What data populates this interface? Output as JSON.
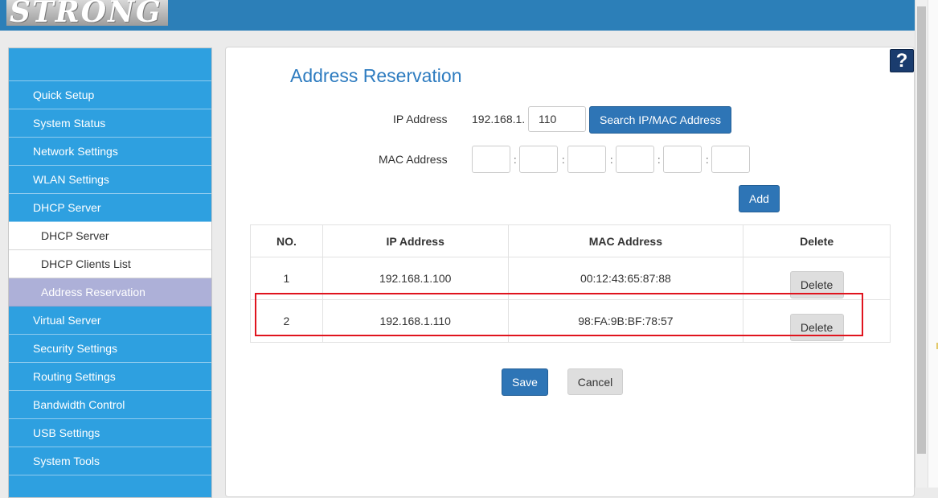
{
  "header": {
    "logo_text": "STRONG"
  },
  "sidebar": {
    "items": [
      {
        "label": "Quick Setup"
      },
      {
        "label": "System Status"
      },
      {
        "label": "Network Settings"
      },
      {
        "label": "WLAN Settings"
      },
      {
        "label": "DHCP Server"
      }
    ],
    "subitems": [
      {
        "label": "DHCP Server"
      },
      {
        "label": "DHCP Clients List"
      },
      {
        "label": "Address Reservation",
        "active": true
      }
    ],
    "items_after": [
      {
        "label": "Virtual Server"
      },
      {
        "label": "Security Settings"
      },
      {
        "label": "Routing Settings"
      },
      {
        "label": "Bandwidth Control"
      },
      {
        "label": "USB Settings"
      },
      {
        "label": "System Tools"
      }
    ]
  },
  "help": {
    "icon": "question-mark-icon",
    "glyph": "?"
  },
  "page": {
    "title": "Address Reservation",
    "ip_label": "IP Address",
    "ip_prefix": "192.168.1.",
    "ip_value": "110",
    "search_button": "Search IP/MAC Address",
    "mac_label": "MAC Address",
    "mac_separator": ":",
    "add_button": "Add"
  },
  "table": {
    "headers": [
      "NO.",
      "IP Address",
      "MAC Address",
      "Delete"
    ],
    "rows": [
      {
        "no": "1",
        "ip": "192.168.1.100",
        "mac": "00:12:43:65:87:88",
        "action": "Delete"
      },
      {
        "no": "2",
        "ip": "192.168.1.110",
        "mac": "98:FA:9B:BF:78:57",
        "action": "Delete",
        "highlighted": true
      }
    ]
  },
  "footer": {
    "save_button": "Save",
    "cancel_button": "Cancel"
  },
  "colors": {
    "topbar": "#2c7fb8",
    "sidebar": "#2ea0e0",
    "active_subitem": "#adb0d8",
    "accent_button": "#2e75b6",
    "highlight_border": "#e0141e",
    "title": "#2e7cc0"
  }
}
